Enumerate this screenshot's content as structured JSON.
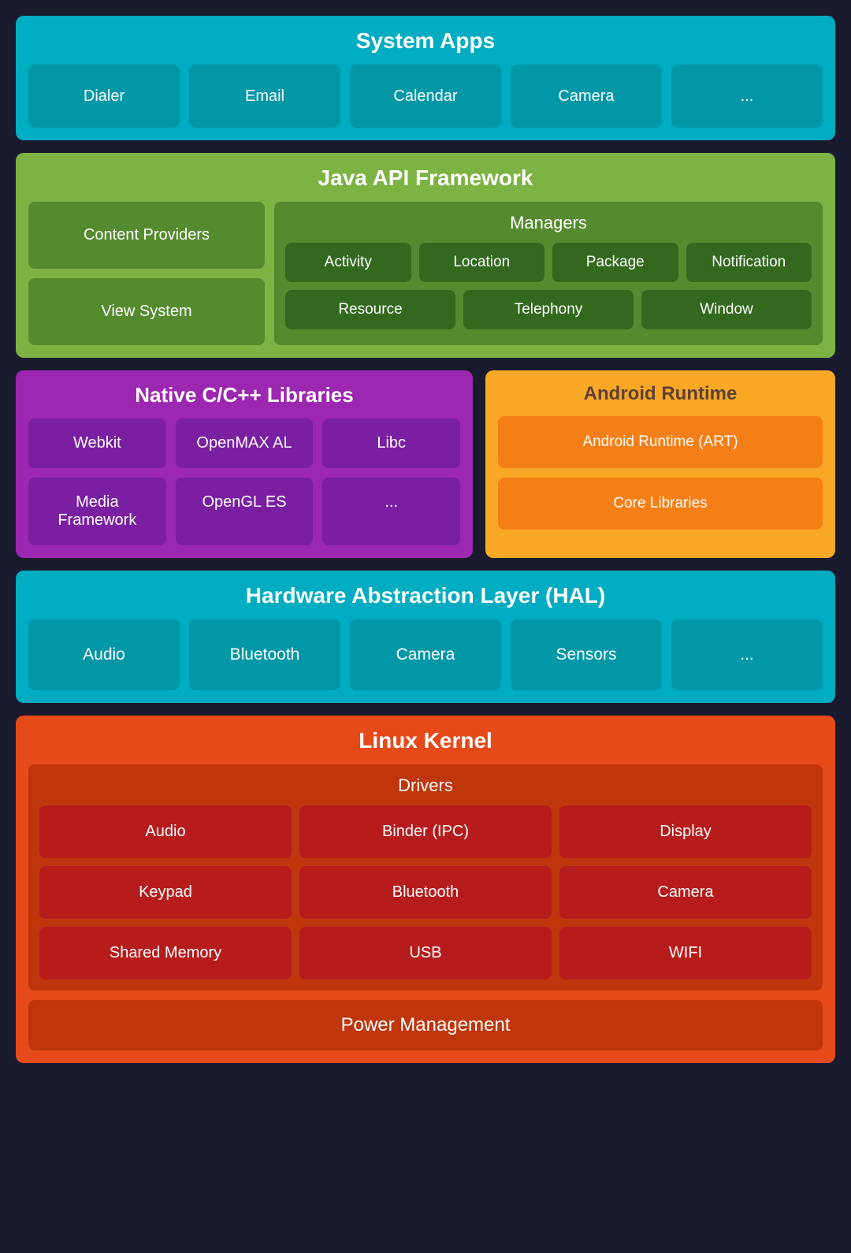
{
  "system_apps": {
    "title": "System Apps",
    "apps": [
      "Dialer",
      "Email",
      "Calendar",
      "Camera",
      "..."
    ]
  },
  "java_api": {
    "title": "Java API Framework",
    "left_items": [
      "Content Providers",
      "View System"
    ],
    "managers_title": "Managers",
    "managers_row1": [
      "Activity",
      "Location",
      "Package",
      "Notification"
    ],
    "managers_row2": [
      "Resource",
      "Telephony",
      "Window"
    ]
  },
  "native": {
    "title": "Native C/C++ Libraries",
    "row1": [
      "Webkit",
      "OpenMAX AL",
      "Libc"
    ],
    "row2": [
      "Media Framework",
      "OpenGL ES",
      "..."
    ]
  },
  "android_runtime": {
    "title": "Android Runtime",
    "cards": [
      "Android Runtime (ART)",
      "Core Libraries"
    ]
  },
  "hal": {
    "title": "Hardware Abstraction Layer (HAL)",
    "items": [
      "Audio",
      "Bluetooth",
      "Camera",
      "Sensors",
      "..."
    ]
  },
  "linux_kernel": {
    "title": "Linux Kernel",
    "drivers_title": "Drivers",
    "drivers_row1": [
      "Audio",
      "Binder (IPC)",
      "Display"
    ],
    "drivers_row2": [
      "Keypad",
      "Bluetooth",
      "Camera"
    ],
    "drivers_row3": [
      "Shared Memory",
      "USB",
      "WIFI"
    ],
    "power_management": "Power Management"
  }
}
